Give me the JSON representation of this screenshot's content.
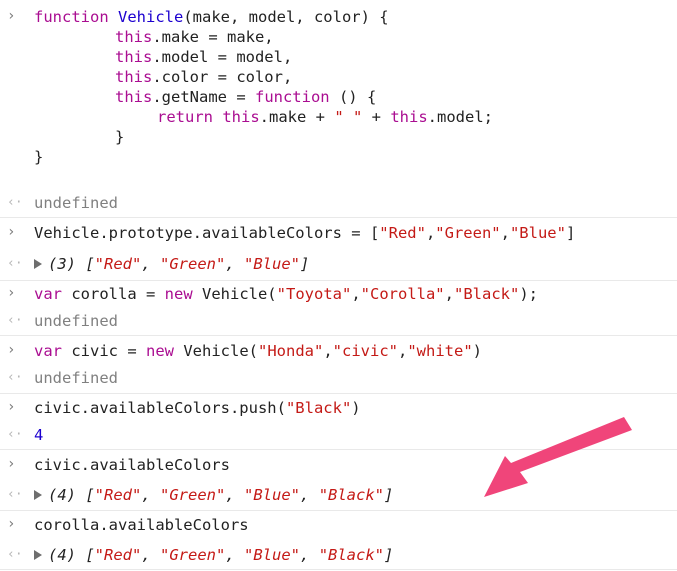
{
  "code": {
    "l1_kw": "function",
    "l1_name": "Vehicle",
    "l1_rest": "(make, model, color) {",
    "l2_this": "this",
    "l2_rest": ".make = make,",
    "l3_this": "this",
    "l3_rest": ".model = model,",
    "l4_this": "this",
    "l4_rest": ".color = color,",
    "l5_this": "this",
    "l5_rest": ".getName = ",
    "l5_kw": "function",
    "l5_tail": " () {",
    "l6_kw": "return",
    "l6_this": "this",
    "l6_mid": ".make + ",
    "l6_str": "\" \"",
    "l6_plus": " + ",
    "l6_this2": "this",
    "l6_tail": ".model;",
    "l7": "}",
    "l8": "}"
  },
  "out1": "undefined",
  "in2": {
    "pre": "Vehicle.prototype.availableColors = [",
    "s1": "\"Red\"",
    "c1": ",",
    "s2": "\"Green\"",
    "c2": ",",
    "s3": "\"Blue\"",
    "post": "]"
  },
  "out2": {
    "count": "(3) [",
    "s1": "\"Red\"",
    "s2": "\"Green\"",
    "s3": "\"Blue\"",
    "sep": ", ",
    "end": "]"
  },
  "in3": {
    "kw": "var",
    "mid": " corolla = ",
    "kw2": "new",
    "call": " Vehicle(",
    "s1": "\"Toyota\"",
    "c1": ",",
    "s2": "\"Corolla\"",
    "c2": ",",
    "s3": "\"Black\"",
    "end": ");"
  },
  "out3": "undefined",
  "in4": {
    "kw": "var",
    "mid": " civic = ",
    "kw2": "new",
    "call": " Vehicle(",
    "s1": "\"Honda\"",
    "c1": ",",
    "s2": "\"civic\"",
    "c2": ",",
    "s3": "\"white\"",
    "end": ")"
  },
  "out4": "undefined",
  "in5": {
    "pre": "civic.availableColors.push(",
    "s1": "\"Black\"",
    "end": ")"
  },
  "out5": "4",
  "in6": "civic.availableColors",
  "out6": {
    "count": "(4) [",
    "s1": "\"Red\"",
    "s2": "\"Green\"",
    "s3": "\"Blue\"",
    "s4": "\"Black\"",
    "sep": ", ",
    "end": "]"
  },
  "in7": "corolla.availableColors",
  "out7": {
    "count": "(4) [",
    "s1": "\"Red\"",
    "s2": "\"Green\"",
    "s3": "\"Blue\"",
    "s4": "\"Black\"",
    "sep": ", ",
    "end": "]"
  },
  "prompt_glyphs": {
    "input": "›",
    "output": "‹·"
  },
  "colors": {
    "keyword": "#aa0d91",
    "function_name": "#1c00cf",
    "string": "#c41a16",
    "undefined": "#808080",
    "arrow": "#f0457a"
  }
}
